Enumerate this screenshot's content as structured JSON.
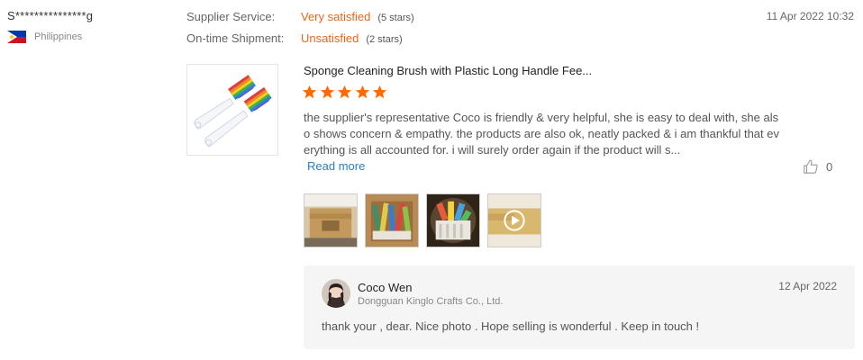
{
  "reviewer": {
    "name": "S***************g",
    "country": "Philippines"
  },
  "ratings": [
    {
      "label": "Supplier Service:",
      "value": "Very satisfied",
      "stars": "(5 stars)",
      "score": 5
    },
    {
      "label": "On-time Shipment:",
      "value": "Unsatisfied",
      "stars": "(2 stars)",
      "score": 2
    }
  ],
  "review_date": "11 Apr 2022 10:32",
  "product": {
    "title": "Sponge Cleaning Brush with Plastic Long Handle Fee...",
    "image_icon": "sponge-brush-image"
  },
  "review": {
    "star_count": 5,
    "star_color": "#ff6a00",
    "lines": [
      "the supplier's representative Coco is friendly & very helpful, she is easy to deal with, she als",
      "o shows concern & empathy. the products are also ok, neatly packed & i am thankful that ev",
      "erything is all accounted for. i will surely order again if the product will s..."
    ],
    "read_more": "Read more",
    "likes": "0"
  },
  "photos": [
    {
      "icon": "package-photo"
    },
    {
      "icon": "brushes-in-box-photo"
    },
    {
      "icon": "brushes-bundle-photo"
    },
    {
      "icon": "video-thumbnail"
    }
  ],
  "reply": {
    "name": "Coco Wen",
    "company": "Dongguan Kinglo Crafts Co., Ltd.",
    "date": "12 Apr 2022",
    "text": "thank your , dear. Nice photo . Hope selling is wonderful . Keep in touch !"
  },
  "colors": {
    "accent_orange": "#e6671a",
    "link_blue": "#2a7fc1",
    "reply_bg": "#f5f5f5"
  }
}
